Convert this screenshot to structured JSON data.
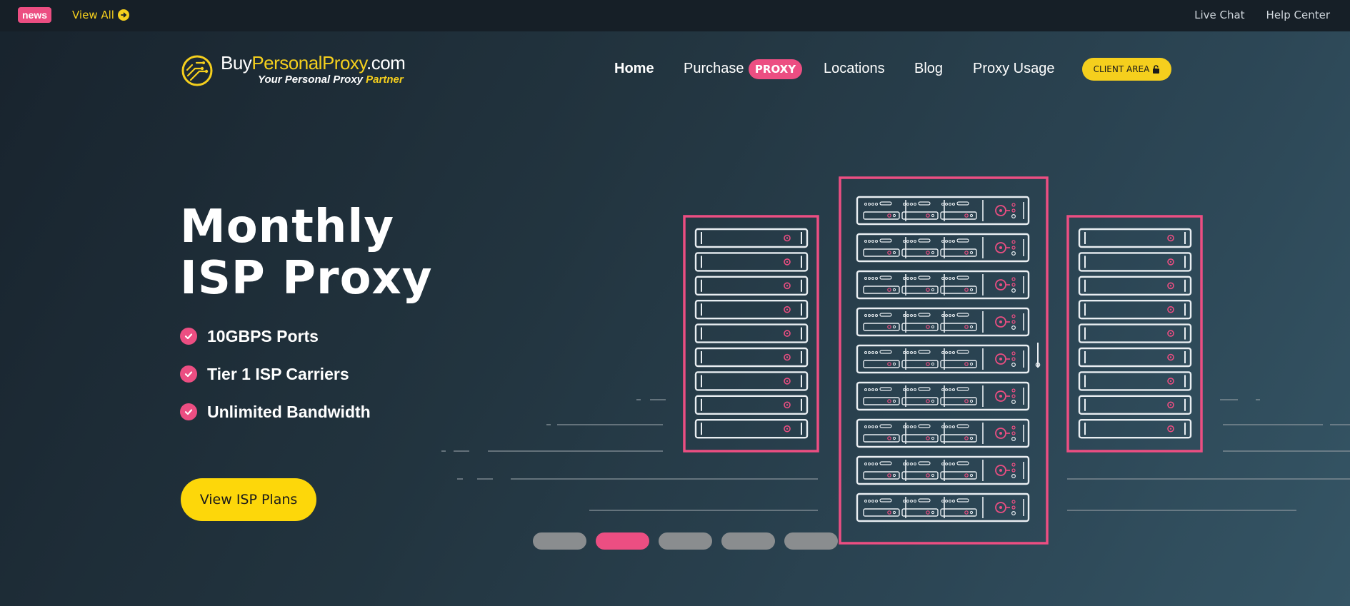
{
  "topbar": {
    "news_badge": "news",
    "view_all": "View All",
    "links": [
      "Live Chat",
      "Help Center"
    ]
  },
  "logo": {
    "part1": "Buy",
    "part2": "Personal",
    "part3": "Proxy",
    "part4": ".com",
    "tagline": "Your Personal Proxy ",
    "tagline_highlight": "Partner"
  },
  "nav": {
    "home": "Home",
    "purchase": "Purchase",
    "proxy_badge": "PROXY",
    "locations": "Locations",
    "blog": "Blog",
    "usage": "Proxy Usage",
    "client_area": "CLIENT AREA"
  },
  "hero": {
    "title_line1": "Monthly",
    "title_line2": "ISP Proxy",
    "features": [
      "10GBPS Ports",
      "Tier 1 ISP Carriers",
      "Unlimited Bandwidth"
    ],
    "cta": "View ISP Plans"
  },
  "carousel": {
    "count": 5,
    "active_index": 1
  },
  "colors": {
    "accent_pink": "#ec4e82",
    "accent_yellow": "#f5cf1d",
    "background_dark": "#18232d"
  },
  "icons": [
    "arrow-circle-right-icon",
    "lock-icon",
    "check-circle-icon",
    "logo-circuit-icon",
    "server-rack-illustration"
  ]
}
